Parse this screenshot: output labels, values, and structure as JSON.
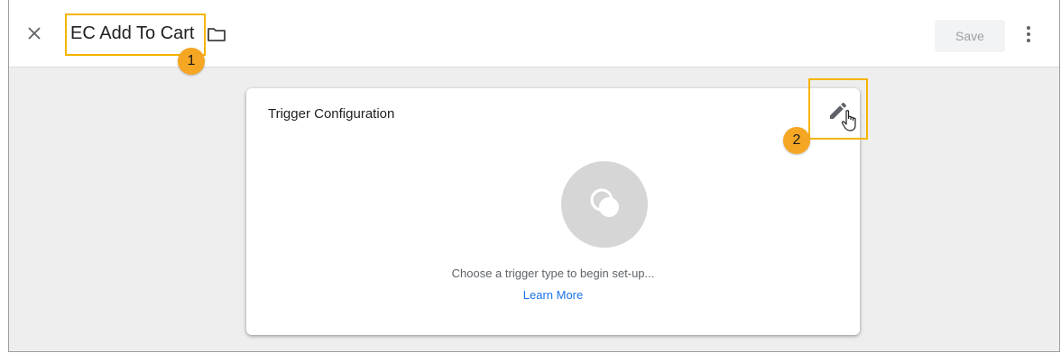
{
  "header": {
    "title": "EC Add To Cart",
    "save_label": "Save",
    "icons": [
      "close-icon",
      "folder-icon",
      "more-vert-icon"
    ]
  },
  "annotations": {
    "step_1": "1",
    "step_2": "2"
  },
  "card": {
    "title": "Trigger Configuration",
    "empty_message": "Choose a trigger type to begin set-up...",
    "learn_more_label": "Learn More",
    "icons": [
      "edit-pencil-icon",
      "trigger-type-icon"
    ]
  },
  "colors": {
    "highlight": "#f5b400",
    "badge": "#f5a623",
    "link": "#1a73e8",
    "disabled_button_bg": "#f1f3f4",
    "disabled_button_text": "#9aa0a6"
  }
}
